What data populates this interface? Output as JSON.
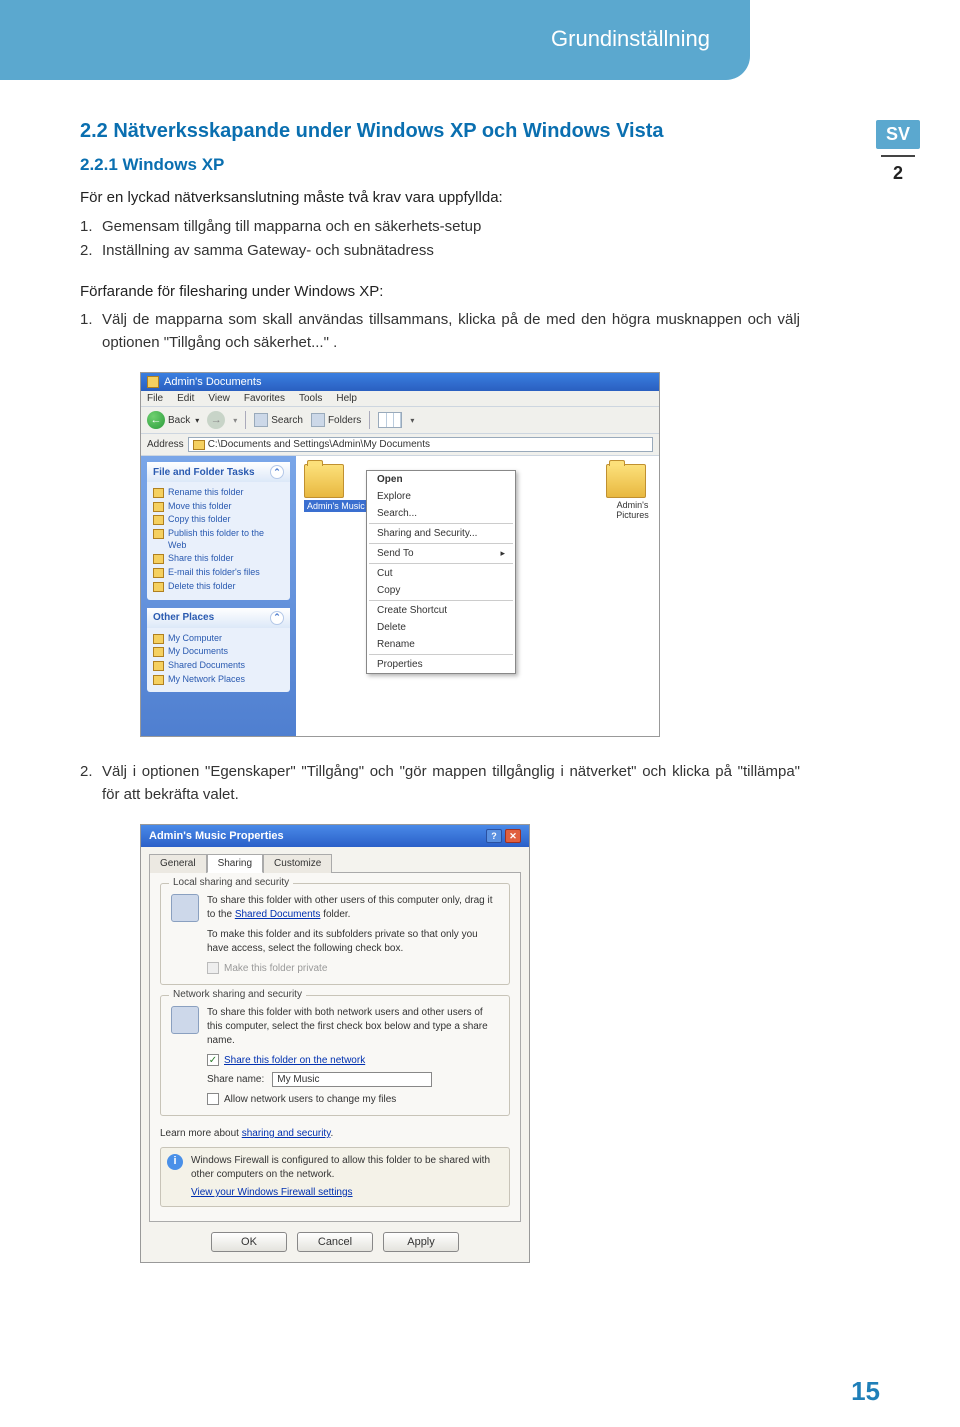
{
  "header": {
    "section_title": "Grundinställning"
  },
  "side": {
    "lang": "SV",
    "chapter": "2"
  },
  "headings": {
    "h2": "2.2 Nätverksskapande under Windows XP och Windows Vista",
    "h3": "2.2.1 Windows XP"
  },
  "intro": "För en lyckad nätverksanslutning måste två krav vara uppfyllda:",
  "reqs": {
    "n1": "1.",
    "t1": "Gemensam tillgång till mapparna och en säkerhets-setup",
    "n2": "2.",
    "t2": "Inställning av samma Gateway- och subnätadress"
  },
  "proc_label": "Förfarande för filesharing under Windows XP:",
  "step1": {
    "n": "1.",
    "t": "Välj de mapparna som skall användas tillsammans, klicka på de med den högra musknappen och välj optionen \"Tillgång och säkerhet...\" ."
  },
  "step2": {
    "n": "2.",
    "t": "Välj i optionen \"Egenskaper\" \"Tillgång\" och \"gör mappen tillgånglig i nätverket\" och klicka på \"tillämpa\" för att bekräfta valet."
  },
  "explorer": {
    "title": "Admin's Documents",
    "menu": [
      "File",
      "Edit",
      "View",
      "Favorites",
      "Tools",
      "Help"
    ],
    "back": "Back",
    "search": "Search",
    "folders": "Folders",
    "address_label": "Address",
    "address_path": "C:\\Documents and Settings\\Admin\\My Documents",
    "task_panel": "File and Folder Tasks",
    "tasks": [
      "Rename this folder",
      "Move this folder",
      "Copy this folder",
      "Publish this folder to the Web",
      "Share this folder",
      "E-mail this folder's files",
      "Delete this folder"
    ],
    "places_panel": "Other Places",
    "places": [
      "My Computer",
      "My Documents",
      "Shared Documents",
      "My Network Places"
    ],
    "selected_folder": "Admin's Music",
    "picture_folder": "Admin's Pictures",
    "ctx": [
      "Open",
      "Explore",
      "Search...",
      "Sharing and Security...",
      "Send To",
      "Cut",
      "Copy",
      "Create Shortcut",
      "Delete",
      "Rename",
      "Properties"
    ]
  },
  "dialog": {
    "title": "Admin's Music Properties",
    "tabs": [
      "General",
      "Sharing",
      "Customize"
    ],
    "group_local": "Local sharing and security",
    "local_line1": "To share this folder with other users of this computer only, drag it to the ",
    "local_link": "Shared Documents",
    "local_line1b": " folder.",
    "local_line2": "To make this folder and its subfolders private so that only you have access, select the following check box.",
    "chk_private": "Make this folder private",
    "group_net": "Network sharing and security",
    "net_text": "To share this folder with both network users and other users of this computer, select the first check box below and type a share name.",
    "chk_share": "Share this folder on the network",
    "share_label": "Share name:",
    "share_value": "My Music",
    "chk_allow": "Allow network users to change my files",
    "learn": "Learn more about ",
    "learn_link": "sharing and security",
    "firewall": "Windows Firewall is configured to allow this folder to be shared with other computers on the network.",
    "fw_link": "View your Windows Firewall settings",
    "ok": "OK",
    "cancel": "Cancel",
    "apply": "Apply"
  },
  "page_number": "15"
}
